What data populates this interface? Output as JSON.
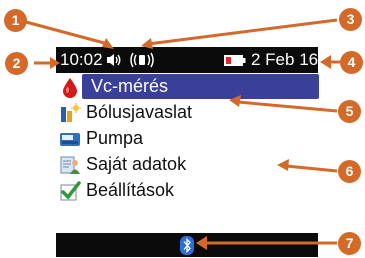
{
  "status_bar": {
    "time": "10:02",
    "speaker_icon": "speaker-icon",
    "vibrate_icon": "vibrate-icon",
    "battery_icon": "battery-low-icon",
    "date": "2 Feb 16"
  },
  "menu": {
    "items": [
      {
        "label": "Vc-mérés",
        "icon": "blood-drop-icon",
        "selected": true
      },
      {
        "label": "Bólusjavaslat",
        "icon": "bolus-advice-icon",
        "selected": false
      },
      {
        "label": "Pumpa",
        "icon": "pump-icon",
        "selected": false
      },
      {
        "label": "Saját adatok",
        "icon": "my-data-icon",
        "selected": false
      },
      {
        "label": "Beállítások",
        "icon": "settings-check-icon",
        "selected": false
      }
    ]
  },
  "bottom_bar": {
    "bluetooth_icon": "bluetooth-icon"
  },
  "callouts": [
    "1",
    "2",
    "3",
    "4",
    "5",
    "6",
    "7"
  ],
  "colors": {
    "callout": "#d36a2a",
    "selection": "#3a3f9a",
    "bar": "#0b0b0b"
  }
}
